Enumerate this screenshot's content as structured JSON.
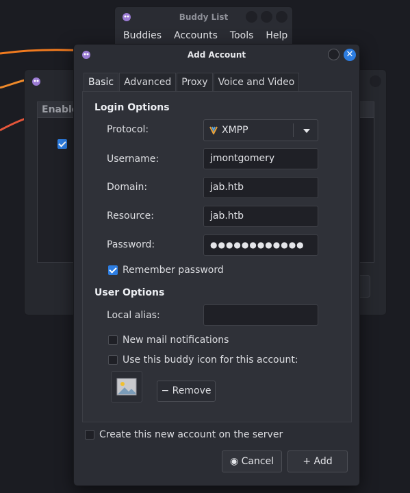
{
  "background": {
    "accent_colors": [
      "#f07a1f",
      "#e4553a"
    ]
  },
  "buddy_list": {
    "title": "Buddy List",
    "menu": [
      "Buddies",
      "Accounts",
      "Tools",
      "Help"
    ]
  },
  "accounts_window": {
    "column_header": "Enable"
  },
  "dialog": {
    "title": "Add Account",
    "tabs": [
      "Basic",
      "Advanced",
      "Proxy",
      "Voice and Video"
    ],
    "login_options": {
      "heading": "Login Options",
      "protocol_label": "Protocol:",
      "protocol_value": "XMPP",
      "username_label": "Username:",
      "username_value": "jmontgomery",
      "domain_label": "Domain:",
      "domain_value": "jab.htb",
      "resource_label": "Resource:",
      "resource_value": "jab.htb",
      "password_label": "Password:",
      "password_value": "●●●●●●●●●●●●",
      "remember_label": "Remember password"
    },
    "user_options": {
      "heading": "User Options",
      "alias_label": "Local alias:",
      "alias_value": "",
      "mail_label": "New mail notifications",
      "icon_label": "Use this buddy icon for this account:",
      "remove_label": "Remove"
    },
    "create_label": "Create this new account on the server",
    "cancel_label": "Cancel",
    "add_label": "Add"
  }
}
